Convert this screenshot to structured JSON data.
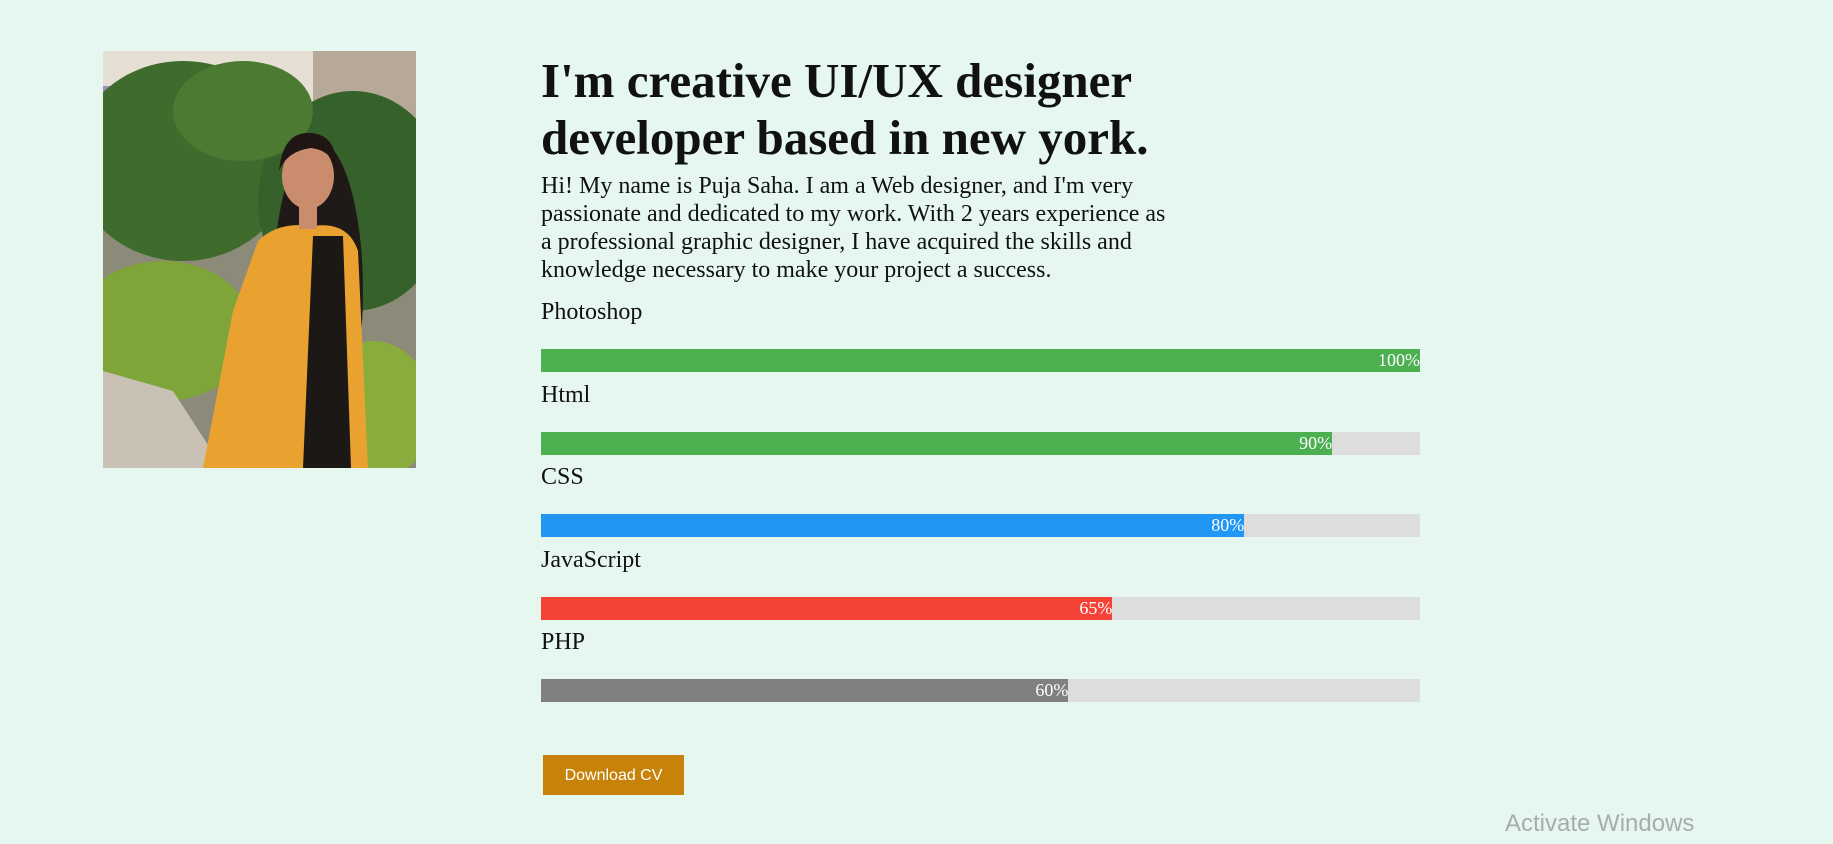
{
  "hero": {
    "headline": "I'm creative UI/UX designer developer based in new york.",
    "bio": "Hi! My name is Puja Saha. I am a Web designer, and I'm very passionate and dedicated to my work. With 2 years experience as a professional graphic designer, I have acquired the skills and knowledge necessary to make your project a success."
  },
  "skills": [
    {
      "name": "Photoshop",
      "percent": 100,
      "label": "100%",
      "color": "#4caf50"
    },
    {
      "name": "Html",
      "percent": 90,
      "label": "90%",
      "color": "#4caf50"
    },
    {
      "name": "CSS",
      "percent": 80,
      "label": "80%",
      "color": "#2196f3"
    },
    {
      "name": "JavaScript",
      "percent": 65,
      "label": "65%",
      "color": "#f44336"
    },
    {
      "name": "PHP",
      "percent": 60,
      "label": "60%",
      "color": "#808080"
    }
  ],
  "colors": {
    "background": "#e5f7ef",
    "bar_track": "#dddddd",
    "button": "#c7820a"
  },
  "button": {
    "download_label": "Download CV"
  },
  "watermark": {
    "text": "Activate Windows"
  }
}
